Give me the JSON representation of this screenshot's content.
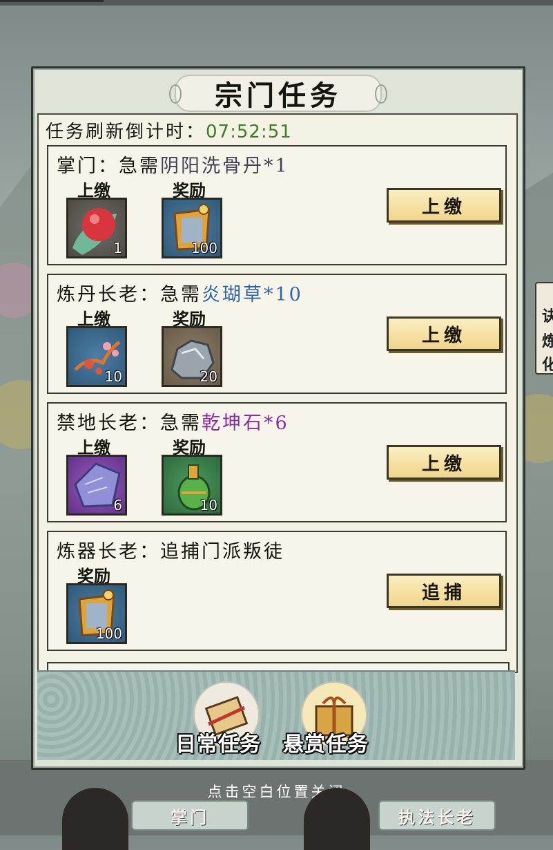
{
  "panel": {
    "title": "宗门任务",
    "timer_label": "任务刷新倒计时：",
    "timer_value": "07:52:51"
  },
  "tasks": [
    {
      "giver": "掌门",
      "request_prefix": "：急需",
      "item_name": "阴阳洗骨丹",
      "item_count": "*1",
      "item_color": "#424056",
      "submit_label": "上缴",
      "reward_label": "奖励",
      "submit_item": {
        "icon": "red-pill-icon",
        "qty": "1"
      },
      "reward_item": {
        "icon": "sect-token-icon",
        "qty": "100"
      },
      "button": "上缴"
    },
    {
      "giver": "炼丹长老",
      "request_prefix": "：急需",
      "item_name": "炎瑚草",
      "item_count": "*10",
      "item_color": "#2f66a6",
      "submit_label": "上缴",
      "reward_label": "奖励",
      "submit_item": {
        "icon": "coral-herb-icon",
        "qty": "10"
      },
      "reward_item": {
        "icon": "silver-ore-icon",
        "qty": "20"
      },
      "button": "上缴"
    },
    {
      "giver": "禁地长老",
      "request_prefix": "：急需",
      "item_name": "乾坤石",
      "item_count": "*6",
      "item_color": "#8a2ea6",
      "submit_label": "上缴",
      "reward_label": "奖励",
      "submit_item": {
        "icon": "purple-stone-icon",
        "qty": "6"
      },
      "reward_item": {
        "icon": "green-gourd-icon",
        "qty": "10"
      },
      "button": "上缴"
    },
    {
      "giver": "炼器长老",
      "request_prefix": "：追捕门派叛徒",
      "reward_label": "奖励",
      "reward_item": {
        "icon": "sect-token-icon",
        "qty": "100"
      },
      "button": "追捕"
    }
  ],
  "tabs": [
    {
      "label": "日常任务",
      "icon": "scroll-icon"
    },
    {
      "label": "悬赏任务",
      "icon": "gift-box-icon"
    }
  ],
  "close_hint": "点击空白位置关闭",
  "characters": [
    {
      "title": "掌门"
    },
    {
      "title": "执法长老"
    }
  ]
}
